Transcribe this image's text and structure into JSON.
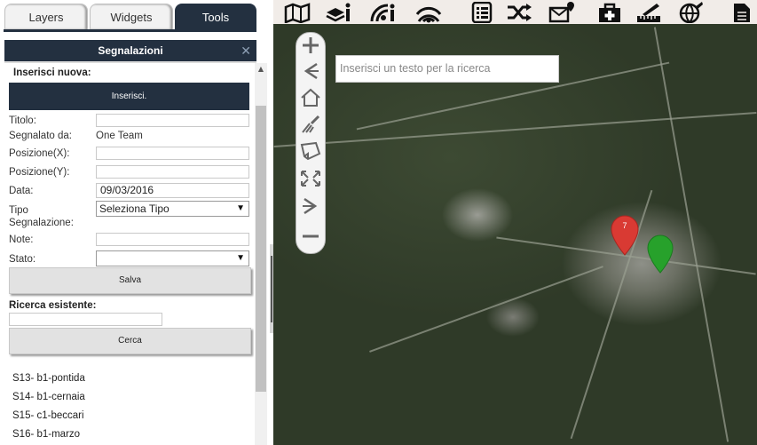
{
  "tabs": [
    {
      "label": "Layers",
      "active": false
    },
    {
      "label": "Widgets",
      "active": false
    },
    {
      "label": "Tools",
      "active": true
    }
  ],
  "panel": {
    "title": "Segnalazioni",
    "close_icon": "close-icon"
  },
  "form": {
    "insert_heading": "Inserisci nuova:",
    "insert_button": "Inserisci.",
    "labels": {
      "titolo": "Titolo:",
      "segnalato": "Segnalato da:",
      "posx": "Posizione(X):",
      "posy": "Posizione(Y):",
      "data": "Data:",
      "tipo": "Tipo Segnalazione:",
      "note": "Note:",
      "stato": "Stato:"
    },
    "values": {
      "titolo": "",
      "segnalato": "One Team",
      "posx": "",
      "posy": "",
      "data": "09/03/2016",
      "tipo": "Seleziona Tipo",
      "note": "",
      "stato": ""
    },
    "save_button": "Salva",
    "search_heading": "Ricerca esistente:",
    "search_value": "",
    "search_button": "Cerca"
  },
  "results": [
    "S13- b1-pontida",
    "S14- b1-cernaia",
    "S15- c1-beccari",
    "S16- b1-marzo"
  ],
  "toolbar_icons": [
    "map-icon",
    "layers-info-icon",
    "signal-info-icon",
    "wifi-signal-icon",
    "list-icon",
    "shuffle-icon",
    "mail-location-icon",
    "first-aid-icon",
    "measure-icon",
    "globe-tools-icon",
    "document-icon"
  ],
  "map": {
    "search_placeholder": "Inserisci un testo per la ricerca",
    "zoom_controls": [
      "zoom-in-icon",
      "back-icon",
      "home-icon",
      "clear-icon",
      "select-icon",
      "full-extent-icon",
      "forward-icon",
      "zoom-out-icon"
    ],
    "markers": [
      {
        "label": "7",
        "color": "#d93a33"
      },
      {
        "label": "",
        "color": "#27a12b"
      }
    ]
  },
  "colors": {
    "accent": "#233040",
    "button_gray": "#e2e2e2"
  }
}
